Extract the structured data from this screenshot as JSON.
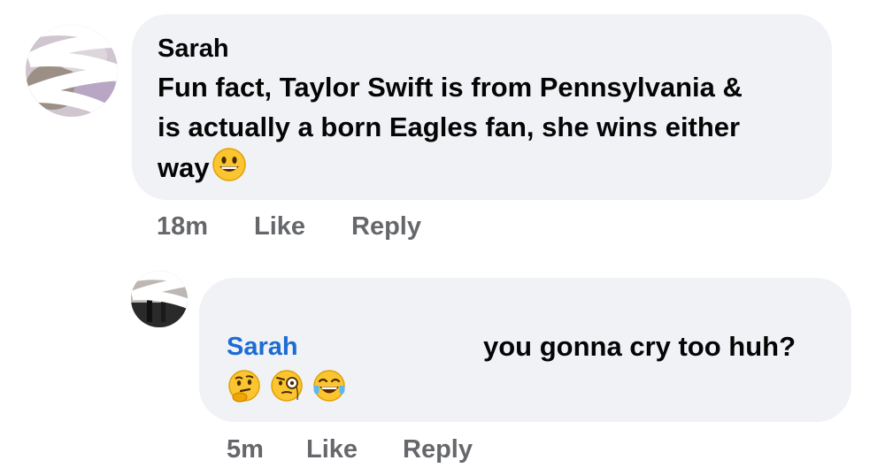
{
  "comments": [
    {
      "author": "Sarah",
      "text_lines": [
        "Fun fact, Taylor Swift is from Pennsylvania &",
        "is actually a born Eagles fan, she wins either",
        "way"
      ],
      "trailing_emoji": "grinning-face",
      "time": "18m",
      "like_label": "Like",
      "reply_label": "Reply"
    },
    {
      "author": "Sarah",
      "text": "you gonna cry too huh?",
      "emojis": [
        "thinking-face",
        "face-with-monocle",
        "face-with-tears-of-joy"
      ],
      "time": "5m",
      "like_label": "Like",
      "reply_label": "Reply"
    }
  ],
  "colors": {
    "bubble": "#f0f2f5",
    "mention_blue": "#1c6cd4",
    "meta_gray": "#65676b",
    "emoji_yellow": "#fbc531"
  }
}
